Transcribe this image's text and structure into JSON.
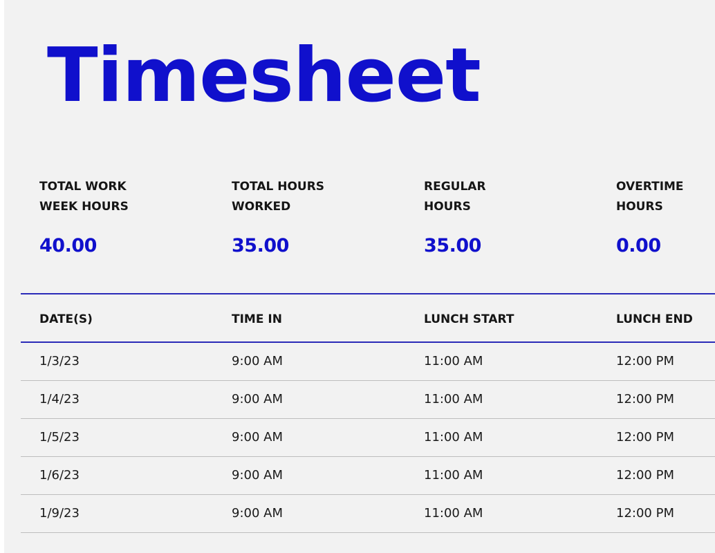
{
  "title": "Timesheet",
  "summary": [
    {
      "label_line1": "TOTAL WORK",
      "label_line2": "WEEK HOURS",
      "value": "40.00"
    },
    {
      "label_line1": "TOTAL HOURS",
      "label_line2": "WORKED",
      "value": "35.00"
    },
    {
      "label_line1": "REGULAR",
      "label_line2": "HOURS",
      "value": "35.00"
    },
    {
      "label_line1": "OVERTIME",
      "label_line2": "HOURS",
      "value": "0.00"
    }
  ],
  "table": {
    "headers": [
      "DATE(S)",
      "TIME IN",
      "LUNCH START",
      "LUNCH END"
    ],
    "rows": [
      [
        "1/3/23",
        "9:00 AM",
        "11:00 AM",
        "12:00 PM"
      ],
      [
        "1/4/23",
        "9:00 AM",
        "11:00 AM",
        "12:00 PM"
      ],
      [
        "1/5/23",
        "9:00 AM",
        "11:00 AM",
        "12:00 PM"
      ],
      [
        "1/6/23",
        "9:00 AM",
        "11:00 AM",
        "12:00 PM"
      ],
      [
        "1/9/23",
        "9:00 AM",
        "11:00 AM",
        "12:00 PM"
      ]
    ]
  },
  "colors": {
    "accent": "#1010cc",
    "rule": "#2a2ab8",
    "row_divider": "#bdbdbd",
    "page_background": "#f2f2f2"
  }
}
